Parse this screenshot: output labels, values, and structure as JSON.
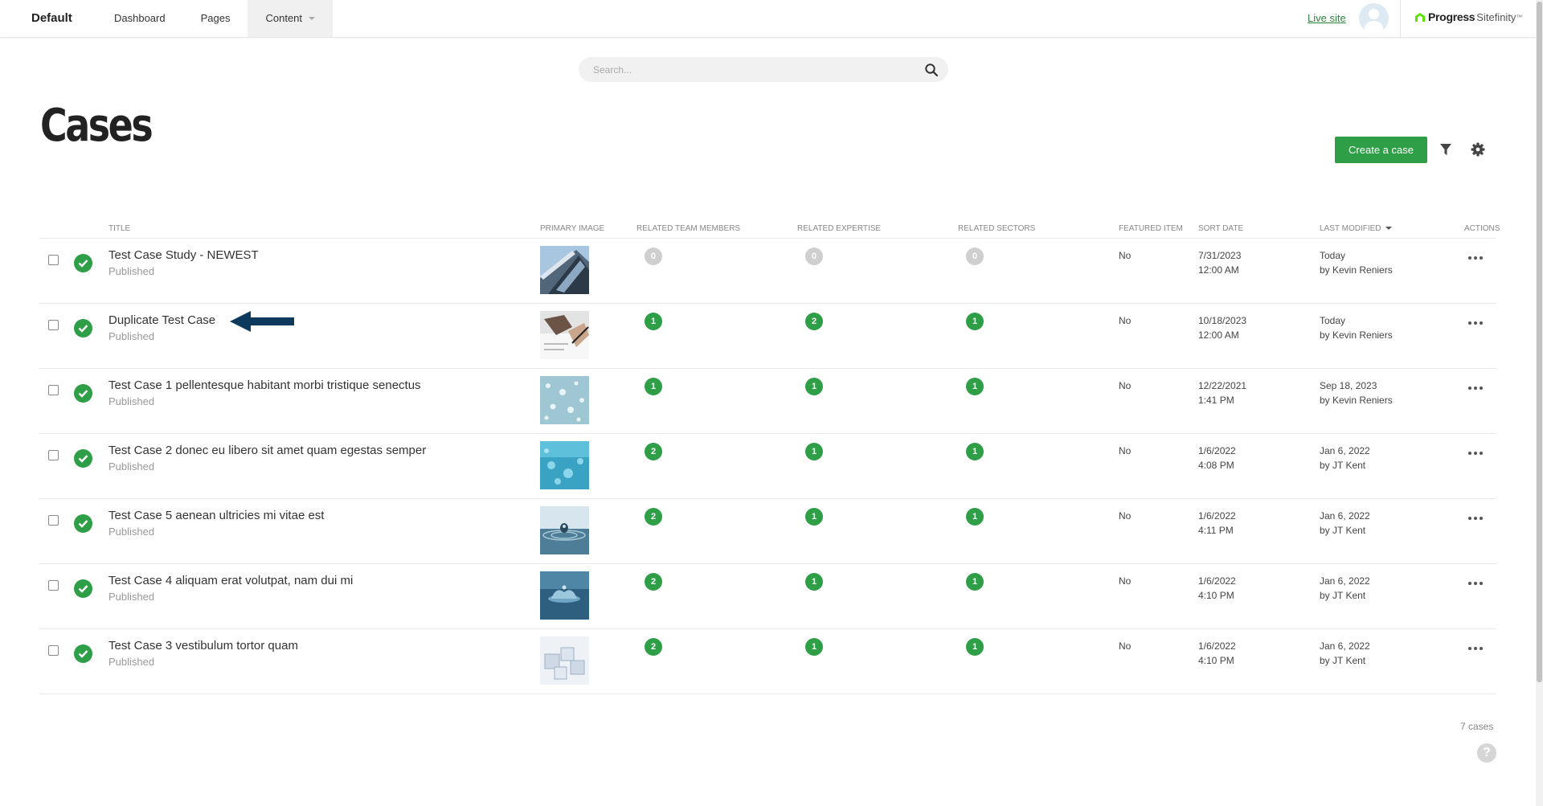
{
  "header": {
    "site_name": "Default",
    "nav": [
      {
        "label": "Dashboard"
      },
      {
        "label": "Pages"
      },
      {
        "label": "Content"
      }
    ],
    "live_site": "Live site",
    "logo_progress": "Progress",
    "logo_sitefinity": "Sitefinity",
    "logo_trademark": "™"
  },
  "search": {
    "placeholder": "Search..."
  },
  "page": {
    "title": "Cases",
    "create_button": "Create a case",
    "footer_count": "7 cases",
    "help": "?"
  },
  "columns": {
    "title": "TITLE",
    "primary_image": "PRIMARY IMAGE",
    "related_team_members": "RELATED TEAM MEMBERS",
    "related_expertise": "RELATED EXPERTISE",
    "related_sectors": "RELATED SECTORS",
    "featured_item": "FEATURED ITEM",
    "sort_date": "SORT DATE",
    "last_modified": "LAST MODIFIED",
    "actions": "ACTIONS"
  },
  "rows": [
    {
      "title": "Test Case Study - NEWEST",
      "status": "Published",
      "team": "0",
      "expertise": "0",
      "sectors": "0",
      "featured": "No",
      "sort_date": "7/31/2023",
      "sort_time": "12:00 AM",
      "modified": "Today",
      "modified_by": "by Kevin Reniers",
      "image": "building glass facade"
    },
    {
      "title": "Duplicate Test Case",
      "status": "Published",
      "team": "1",
      "expertise": "2",
      "sectors": "1",
      "featured": "No",
      "sort_date": "10/18/2023",
      "sort_time": "12:00 AM",
      "modified": "Today",
      "modified_by": "by Kevin Reniers",
      "image": "hand writing on paper"
    },
    {
      "title": "Test Case 1 pellentesque habitant morbi tristique senectus",
      "status": "Published",
      "team": "1",
      "expertise": "1",
      "sectors": "1",
      "featured": "No",
      "sort_date": "12/22/2021",
      "sort_time": "1:41 PM",
      "modified": "Sep 18, 2023",
      "modified_by": "by Kevin Reniers",
      "image": "water droplets light"
    },
    {
      "title": "Test Case 2 donec eu libero sit amet quam egestas semper",
      "status": "Published",
      "team": "2",
      "expertise": "1",
      "sectors": "1",
      "featured": "No",
      "sort_date": "1/6/2022",
      "sort_time": "4:08 PM",
      "modified": "Jan 6, 2022",
      "modified_by": "by JT Kent",
      "image": "water droplets blue"
    },
    {
      "title": "Test Case 5 aenean ultricies mi vitae est",
      "status": "Published",
      "team": "2",
      "expertise": "1",
      "sectors": "1",
      "featured": "No",
      "sort_date": "1/6/2022",
      "sort_time": "4:11 PM",
      "modified": "Jan 6, 2022",
      "modified_by": "by JT Kent",
      "image": "water drop ripple"
    },
    {
      "title": "Test Case 4 aliquam erat volutpat, nam dui mi",
      "status": "Published",
      "team": "2",
      "expertise": "1",
      "sectors": "1",
      "featured": "No",
      "sort_date": "1/6/2022",
      "sort_time": "4:10 PM",
      "modified": "Jan 6, 2022",
      "modified_by": "by JT Kent",
      "image": "water splash"
    },
    {
      "title": "Test Case 3 vestibulum tortor quam",
      "status": "Published",
      "team": "2",
      "expertise": "1",
      "sectors": "1",
      "featured": "No",
      "sort_date": "1/6/2022",
      "sort_time": "4:10 PM",
      "modified": "Jan 6, 2022",
      "modified_by": "by JT Kent",
      "image": "ice cubes"
    }
  ],
  "colors": {
    "accent_green": "#2e9e47",
    "annotation_arrow": "#0d3a5c",
    "count_zero": "#cfcfcf"
  }
}
